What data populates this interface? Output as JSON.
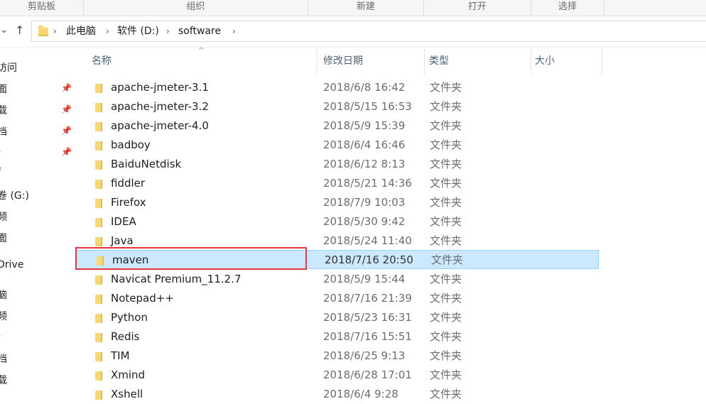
{
  "ribbon": {
    "groups": [
      "剪贴板",
      "组织",
      "新建",
      "打开",
      "选择"
    ]
  },
  "address": {
    "crumbs": [
      "此电脑",
      "软件 (D:)",
      "software"
    ]
  },
  "nav": {
    "items": [
      "访问",
      "面",
      "载",
      "档",
      "-",
      "f",
      "卷 (G:)",
      "频",
      "面",
      "Drive",
      "脑",
      "频",
      "-",
      "档",
      "载"
    ]
  },
  "columns": {
    "name": "名称",
    "date": "修改日期",
    "type": "类型",
    "size": "大小"
  },
  "files": [
    {
      "name": "apache-jmeter-3.1",
      "date": "2018/6/8 16:42",
      "type": "文件夹"
    },
    {
      "name": "apache-jmeter-3.2",
      "date": "2018/5/15 16:53",
      "type": "文件夹"
    },
    {
      "name": "apache-jmeter-4.0",
      "date": "2018/5/9 15:39",
      "type": "文件夹"
    },
    {
      "name": "badboy",
      "date": "2018/6/4 16:46",
      "type": "文件夹"
    },
    {
      "name": "BaiduNetdisk",
      "date": "2018/6/12 8:13",
      "type": "文件夹"
    },
    {
      "name": "fiddler",
      "date": "2018/5/21 14:36",
      "type": "文件夹"
    },
    {
      "name": "Firefox",
      "date": "2018/7/9 10:03",
      "type": "文件夹"
    },
    {
      "name": "IDEA",
      "date": "2018/5/30 9:42",
      "type": "文件夹"
    },
    {
      "name": "Java",
      "date": "2018/5/24 11:40",
      "type": "文件夹"
    },
    {
      "name": "maven",
      "date": "2018/7/16 20:50",
      "type": "文件夹"
    },
    {
      "name": "Navicat Premium_11.2.7",
      "date": "2018/5/9 15:44",
      "type": "文件夹"
    },
    {
      "name": "Notepad++",
      "date": "2018/7/16 21:39",
      "type": "文件夹"
    },
    {
      "name": "Python",
      "date": "2018/5/23 16:31",
      "type": "文件夹"
    },
    {
      "name": "Redis",
      "date": "2018/7/16 15:51",
      "type": "文件夹"
    },
    {
      "name": "TIM",
      "date": "2018/6/25 9:13",
      "type": "文件夹"
    },
    {
      "name": "Xmind",
      "date": "2018/6/28 17:01",
      "type": "文件夹"
    },
    {
      "name": "Xshell",
      "date": "2018/6/4 9:28",
      "type": "文件夹"
    }
  ]
}
